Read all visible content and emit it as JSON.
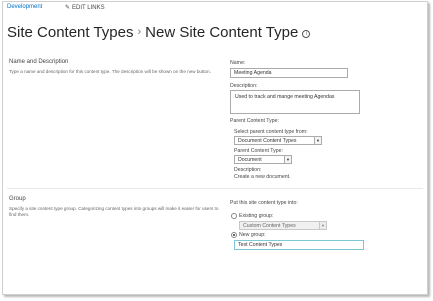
{
  "topnav": {
    "site_link": "Development",
    "edit_links": "EDIT LINKS"
  },
  "header": {
    "breadcrumb_parent": "Site Content Types",
    "separator": "›",
    "page_title": "New Site Content Type",
    "info_glyph": "i"
  },
  "name_section": {
    "title": "Name and Description",
    "description": "Type a name and description for this content type. The description will be shown on the new button.",
    "name_label": "Name:",
    "name_value": "Meeting Agenda",
    "description_label": "Description:",
    "description_value": "Used to track and mange meeting Agendas",
    "parent_label": "Parent Content Type:",
    "select_from_label": "Select parent content type from:",
    "select_from_value": "Document Content Types",
    "parent_type_label": "Parent Content Type:",
    "parent_type_value": "Document",
    "desc_label": "Description:",
    "desc_value": "Create a new document."
  },
  "group_section": {
    "title": "Group",
    "description": "Specify a site content type group. Categorizing content types into groups will make it easier for users to find them.",
    "put_into_label": "Put this site content type into:",
    "existing_label": "Existing group:",
    "existing_value": "Custom Content Types",
    "new_label": "New group:",
    "new_value": "Test Content Types"
  },
  "colors": {
    "link": "#0072c6",
    "title": "#262626",
    "focus_border": "#7ec7d8"
  }
}
